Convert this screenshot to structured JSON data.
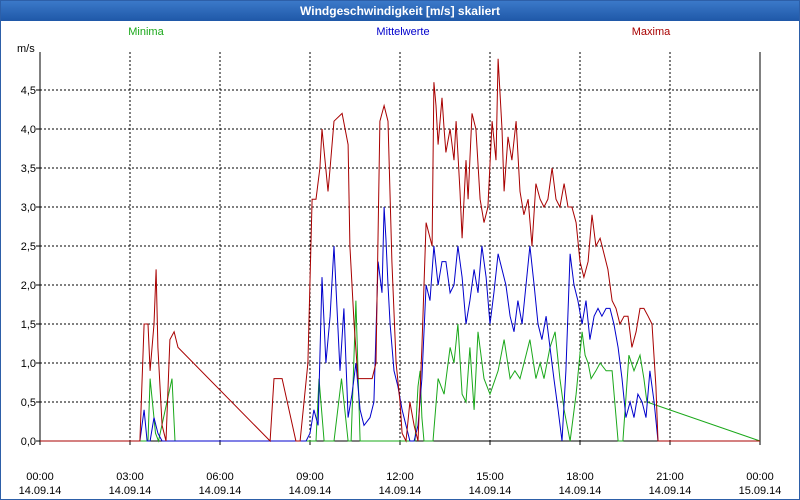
{
  "window": {
    "title": "Windgeschwindigkeit [m/s] skaliert"
  },
  "colors": {
    "minima": "#1aa81a",
    "mittel": "#0000cc",
    "maxima": "#a80000",
    "grid": "#000000"
  },
  "chart_data": {
    "type": "line",
    "title": "Windgeschwindigkeit [m/s] skaliert",
    "ylabel": "m/s",
    "xlabel": "",
    "ylim": [
      0,
      5.2
    ],
    "xlim_hours": [
      0,
      24
    ],
    "y_ticks": [
      "0,0",
      "0,5",
      "1,0",
      "1,5",
      "2,0",
      "2,5",
      "3,0",
      "3,5",
      "4,0",
      "4,5"
    ],
    "x_ticks": [
      {
        "time": "00:00",
        "date": "14.09.14"
      },
      {
        "time": "03:00",
        "date": "14.09.14"
      },
      {
        "time": "06:00",
        "date": "14.09.14"
      },
      {
        "time": "09:00",
        "date": "14.09.14"
      },
      {
        "time": "12:00",
        "date": "14.09.14"
      },
      {
        "time": "15:00",
        "date": "14.09.14"
      },
      {
        "time": "18:00",
        "date": "14.09.14"
      },
      {
        "time": "21:00",
        "date": "14.09.14"
      },
      {
        "time": "00:00",
        "date": "15.09.14"
      }
    ],
    "grid": true,
    "legend_position": "top",
    "series": [
      {
        "name": "Minima",
        "color": "#1aa81a",
        "x": [
          0,
          3.6,
          3.67,
          3.85,
          3.95,
          4.4,
          4.5,
          4.7,
          9.2,
          9.3,
          9.47,
          9.63,
          9.8,
          10.05,
          10.27,
          10.37,
          10.53,
          10.67,
          11.27,
          11.37,
          11.45,
          11.55,
          11.67,
          11.83,
          12.5,
          12.6,
          12.67,
          12.73,
          12.8,
          12.9,
          13.1,
          13.27,
          13.47,
          13.67,
          13.8,
          13.93,
          14.07,
          14.2,
          14.33,
          14.47,
          14.6,
          14.8,
          15.0,
          15.27,
          15.47,
          15.67,
          15.83,
          16.0,
          16.2,
          16.33,
          16.53,
          16.67,
          16.8,
          17.0,
          17.17,
          17.33,
          17.47,
          17.67,
          17.87,
          18.07,
          18.17,
          18.27,
          18.37,
          18.53,
          18.67,
          18.87,
          19.07,
          19.27,
          19.43,
          19.63,
          19.8,
          20.0,
          20.13,
          20.23,
          24
        ],
        "y": [
          0,
          0,
          0.8,
          0.1,
          0,
          0.8,
          0,
          0,
          0,
          0.8,
          0,
          0,
          0,
          0.8,
          0,
          0,
          1.8,
          0,
          0,
          0,
          0,
          0,
          0,
          0,
          0,
          0.7,
          0.9,
          0.3,
          0,
          0,
          0,
          0.8,
          0.6,
          1.2,
          1.0,
          1.5,
          0.6,
          0.5,
          1.2,
          0.4,
          1.4,
          0.8,
          0.6,
          0.9,
          1.3,
          0.8,
          0.9,
          0.8,
          1.1,
          1.3,
          0.8,
          1.0,
          0.8,
          1.2,
          1.4,
          0.8,
          0.4,
          0,
          0.6,
          1.4,
          1.1,
          1.0,
          0.8,
          0.9,
          1.0,
          0.9,
          0.9,
          0,
          0,
          1.1,
          0.9,
          1.1,
          0.8,
          0.5,
          0
        ]
      },
      {
        "name": "Mittelwerte",
        "color": "#0000cc",
        "x": [
          0,
          3.33,
          3.47,
          3.57,
          3.67,
          3.8,
          3.93,
          4.07,
          4.2,
          8.87,
          9.0,
          9.13,
          9.27,
          9.4,
          9.53,
          9.67,
          9.8,
          10.0,
          10.13,
          10.27,
          10.4,
          10.53,
          10.67,
          10.8,
          11.0,
          11.13,
          11.27,
          11.4,
          11.47,
          11.53,
          11.6,
          11.67,
          11.8,
          11.93,
          12.07,
          12.2,
          12.33,
          12.47,
          12.6,
          12.73,
          12.87,
          13.0,
          13.13,
          13.27,
          13.4,
          13.53,
          13.67,
          13.8,
          13.93,
          14.07,
          14.2,
          14.33,
          14.47,
          14.6,
          14.73,
          14.87,
          15.0,
          15.13,
          15.27,
          15.4,
          15.53,
          15.67,
          15.8,
          15.93,
          16.07,
          16.2,
          16.33,
          16.47,
          16.6,
          16.73,
          16.87,
          17.0,
          17.13,
          17.27,
          17.4,
          17.53,
          17.67,
          17.8,
          17.93,
          18.07,
          18.2,
          18.33,
          18.47,
          18.6,
          18.73,
          18.87,
          19.0,
          19.13,
          19.27,
          19.4,
          19.53,
          19.67,
          19.8,
          19.93,
          20.07,
          20.2,
          20.33,
          20.47,
          20.6,
          24
        ],
        "y": [
          0,
          0,
          0.4,
          0,
          0,
          0.3,
          0.1,
          0,
          0,
          0,
          0.1,
          0.4,
          0.2,
          2.1,
          1.0,
          1.6,
          2.5,
          0.9,
          1.7,
          0.3,
          0.6,
          1.0,
          0.4,
          0.2,
          0.3,
          0.5,
          2.3,
          1.9,
          3.0,
          2.6,
          2.0,
          1.5,
          0.9,
          0.7,
          0.4,
          0.2,
          0,
          0,
          0.2,
          0.8,
          2.0,
          1.8,
          2.5,
          2.0,
          2.3,
          2.3,
          1.9,
          2.0,
          2.5,
          2.1,
          1.5,
          1.8,
          2.2,
          1.9,
          2.5,
          2.1,
          1.5,
          1.9,
          2.4,
          2.2,
          2.0,
          1.6,
          1.4,
          1.8,
          1.5,
          2.0,
          2.5,
          2.0,
          1.5,
          1.3,
          1.6,
          1.2,
          0.8,
          0.4,
          0,
          0.9,
          2.4,
          2.0,
          1.8,
          1.5,
          1.8,
          1.3,
          1.6,
          1.7,
          1.6,
          1.7,
          1.7,
          1.5,
          1.2,
          0.8,
          0.3,
          0.5,
          0.3,
          0.6,
          0.5,
          0.3,
          0.9,
          0.5,
          0,
          0
        ]
      },
      {
        "name": "Maxima",
        "color": "#a80000",
        "x": [
          0,
          3.33,
          3.47,
          3.6,
          3.67,
          3.8,
          3.87,
          3.93,
          4.07,
          4.2,
          4.33,
          4.47,
          4.6,
          7.67,
          7.8,
          8.07,
          8.53,
          8.67,
          8.93,
          9.07,
          9.2,
          9.33,
          9.4,
          9.5,
          9.6,
          9.67,
          9.8,
          10.07,
          10.27,
          10.33,
          10.47,
          10.6,
          10.73,
          11.0,
          11.07,
          11.2,
          11.33,
          11.47,
          11.6,
          11.73,
          11.87,
          12.0,
          12.07,
          12.2,
          12.33,
          12.47,
          12.6,
          12.73,
          12.87,
          13.07,
          13.13,
          13.2,
          13.27,
          13.4,
          13.47,
          13.53,
          13.67,
          13.8,
          13.87,
          14.0,
          14.07,
          14.2,
          14.27,
          14.4,
          14.53,
          14.67,
          14.8,
          14.93,
          15.07,
          15.2,
          15.27,
          15.4,
          15.47,
          15.6,
          15.73,
          15.87,
          16.0,
          16.13,
          16.27,
          16.4,
          16.53,
          16.67,
          16.8,
          16.93,
          17.07,
          17.2,
          17.33,
          17.47,
          17.6,
          17.73,
          17.87,
          18.0,
          18.13,
          18.27,
          18.4,
          18.53,
          18.67,
          18.8,
          18.93,
          19.07,
          19.2,
          19.33,
          19.47,
          19.6,
          19.73,
          19.87,
          20.0,
          20.13,
          20.27,
          20.4,
          20.53,
          20.6,
          24
        ],
        "y": [
          0,
          0,
          1.5,
          1.5,
          0.9,
          1.5,
          2.2,
          1.2,
          0.2,
          0,
          1.3,
          1.4,
          1.2,
          0,
          0.8,
          0.8,
          0,
          0,
          1.0,
          3.1,
          3.1,
          3.5,
          4.0,
          3.6,
          3.2,
          3.5,
          4.1,
          4.2,
          3.8,
          2.5,
          1.5,
          0.8,
          0.8,
          0.8,
          0.8,
          1.0,
          4.1,
          4.3,
          4.1,
          2.3,
          1.0,
          0.5,
          0.1,
          0,
          0.5,
          0.2,
          0,
          1.2,
          2.8,
          2.5,
          4.6,
          4.3,
          3.8,
          4.4,
          4.0,
          3.7,
          4.0,
          3.6,
          4.1,
          3.2,
          2.6,
          3.6,
          3.1,
          4.2,
          4.0,
          3.1,
          2.8,
          3.0,
          4.1,
          3.6,
          4.9,
          4.0,
          3.2,
          3.9,
          3.6,
          4.1,
          3.2,
          2.9,
          3.1,
          2.5,
          3.3,
          3.1,
          3.0,
          3.1,
          3.5,
          3.1,
          3.0,
          3.3,
          3.0,
          3.0,
          2.8,
          2.3,
          2.1,
          2.3,
          2.9,
          2.5,
          2.6,
          2.4,
          2.2,
          1.8,
          1.7,
          1.5,
          1.6,
          1.6,
          1.2,
          1.4,
          1.7,
          1.7,
          1.6,
          1.5,
          0.7,
          0,
          0
        ]
      }
    ]
  }
}
